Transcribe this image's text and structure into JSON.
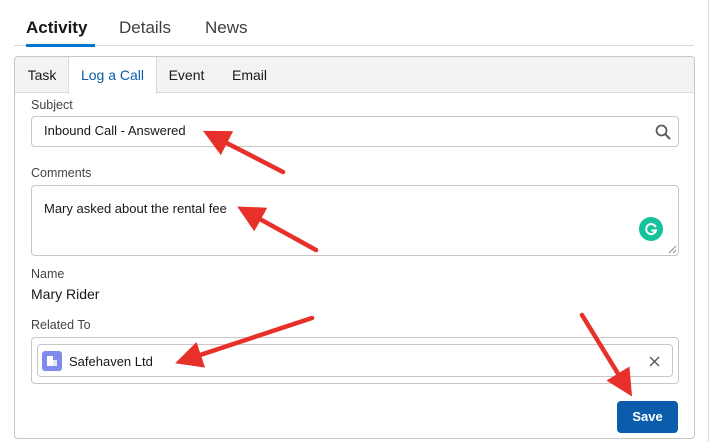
{
  "top_tabs": [
    {
      "label": "Activity",
      "active": true
    },
    {
      "label": "Details",
      "active": false
    },
    {
      "label": "News",
      "active": false
    }
  ],
  "sub_tabs": [
    {
      "label": "Task",
      "active": false
    },
    {
      "label": "Log a Call",
      "active": true
    },
    {
      "label": "Event",
      "active": false
    },
    {
      "label": "Email",
      "active": false
    }
  ],
  "form": {
    "subject_label": "Subject",
    "subject_value": "Inbound Call - Answered",
    "comments_label": "Comments",
    "comments_value": "Mary asked about the rental fee",
    "name_label": "Name",
    "name_value": "Mary Rider",
    "related_label": "Related To",
    "related_value": "Safehaven Ltd",
    "save_label": "Save"
  },
  "icons": {
    "subject_search": "search-icon",
    "comments_assistant": "grammarly-icon",
    "related_account": "account-icon",
    "related_clear": "close-icon"
  },
  "colors": {
    "accent_tab": "#0176d3",
    "active_subtab_text": "#0b5cab",
    "save_button": "#0b5cab",
    "annotation_arrow": "#e8302a",
    "grammarly": "#15c39a",
    "account_icon": "#7f8ced"
  }
}
